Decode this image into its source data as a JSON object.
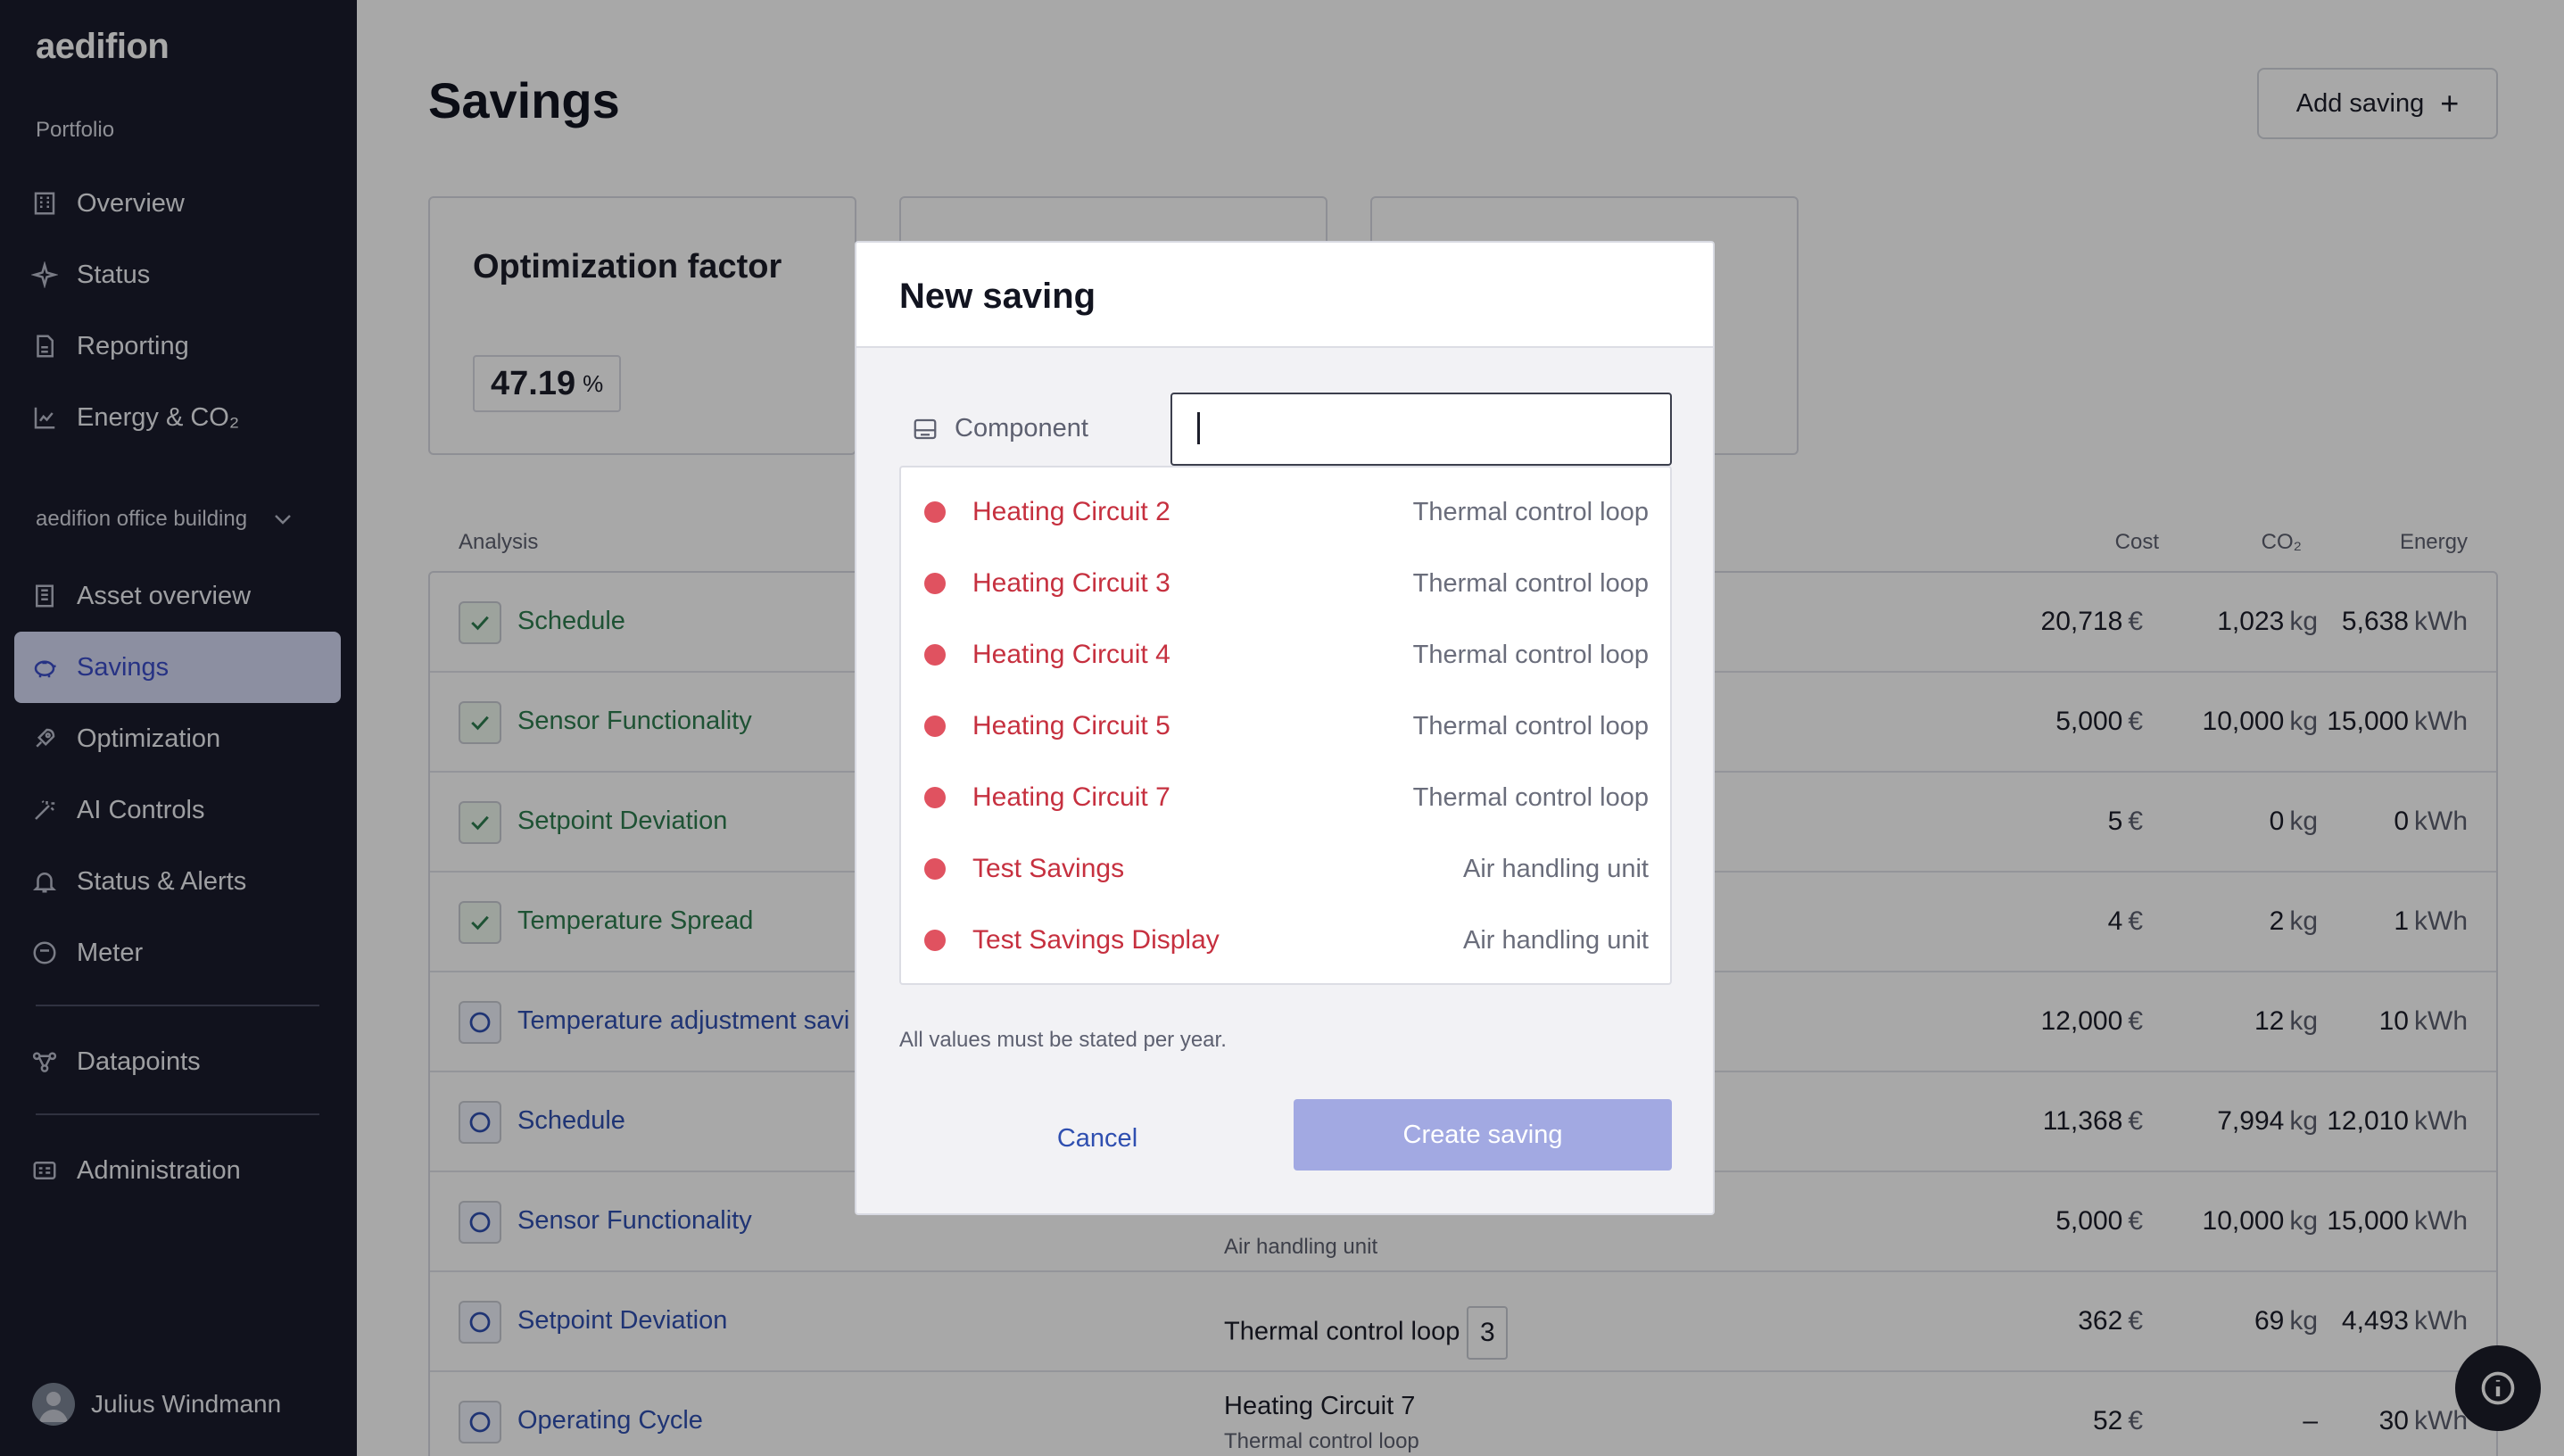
{
  "sidebar": {
    "logo": "aedifion",
    "portfolio_label": "Portfolio",
    "portfolio_items": [
      {
        "label": "Overview",
        "icon": "building-icon"
      },
      {
        "label": "Status",
        "icon": "sparkle-icon"
      },
      {
        "label": "Reporting",
        "icon": "report-icon"
      },
      {
        "label": "Energy & CO₂",
        "icon": "chart-icon"
      }
    ],
    "building_selector": "aedifion office building",
    "building_items": [
      {
        "label": "Asset overview",
        "icon": "asset-icon"
      },
      {
        "label": "Savings",
        "icon": "piggy-bank-icon",
        "active": true
      },
      {
        "label": "Optimization",
        "icon": "rocket-icon"
      },
      {
        "label": "AI Controls",
        "icon": "magic-wand-icon"
      },
      {
        "label": "Status & Alerts",
        "icon": "bell-icon"
      },
      {
        "label": "Meter",
        "icon": "gauge-icon"
      }
    ],
    "datapoints_label": "Datapoints",
    "administration_label": "Administration",
    "user_name": "Julius Windmann"
  },
  "main": {
    "title": "Savings",
    "add_button": "Add saving",
    "card1": {
      "title": "Optimization factor",
      "value": "47.19",
      "unit": "%"
    },
    "table_headers": {
      "analysis": "Analysis",
      "cost": "Cost",
      "co2": "CO₂",
      "energy": "Energy"
    },
    "rows": [
      {
        "name": "Schedule",
        "status": "checked",
        "comp": "",
        "comp_sub": "",
        "badge": "",
        "cost": "20,718",
        "co2": "1,023",
        "energy": "5,638"
      },
      {
        "name": "Sensor Functionality",
        "status": "checked",
        "comp": "",
        "comp_sub": "",
        "badge": "",
        "cost": "5,000",
        "co2": "10,000",
        "energy": "15,000"
      },
      {
        "name": "Setpoint Deviation",
        "status": "checked",
        "comp": "",
        "comp_sub": "",
        "badge": "",
        "cost": "5",
        "co2": "0",
        "energy": "0"
      },
      {
        "name": "Temperature Spread",
        "status": "checked",
        "comp": "",
        "comp_sub": "",
        "badge": "",
        "cost": "4",
        "co2": "2",
        "energy": "1"
      },
      {
        "name": "Temperature adjustment savi",
        "status": "open",
        "comp": "",
        "comp_sub": "",
        "badge": "",
        "cost": "12,000",
        "co2": "12",
        "energy": "10"
      },
      {
        "name": "Schedule",
        "status": "open",
        "comp": "",
        "comp_sub": "",
        "badge": "",
        "cost": "11,368",
        "co2": "7,994",
        "energy": "12,010"
      },
      {
        "name": "Sensor Functionality",
        "status": "open",
        "comp": "",
        "comp_sub": "Air handling unit",
        "badge": "",
        "cost": "5,000",
        "co2": "10,000",
        "energy": "15,000"
      },
      {
        "name": "Setpoint Deviation",
        "status": "open",
        "comp": "Thermal control loop",
        "comp_sub": "",
        "badge": "3",
        "cost": "362",
        "co2": "69",
        "energy": "4,493"
      },
      {
        "name": "Operating Cycle",
        "status": "open",
        "comp": "Heating Circuit 7",
        "comp_sub": "Thermal control loop",
        "badge": "",
        "cost": "52",
        "co2": "–",
        "energy": "30"
      }
    ],
    "units": {
      "cost": "€",
      "co2": "kg",
      "energy": "kWh"
    }
  },
  "modal": {
    "title": "New saving",
    "component_label": "Component",
    "component_value": "",
    "options": [
      {
        "name": "Heating Circuit 2",
        "type": "Thermal control loop"
      },
      {
        "name": "Heating Circuit 3",
        "type": "Thermal control loop"
      },
      {
        "name": "Heating Circuit 4",
        "type": "Thermal control loop"
      },
      {
        "name": "Heating Circuit 5",
        "type": "Thermal control loop"
      },
      {
        "name": "Heating Circuit 7",
        "type": "Thermal control loop"
      },
      {
        "name": "Test Savings",
        "type": "Air handling unit"
      },
      {
        "name": "Test Savings Display",
        "type": "Air handling unit"
      }
    ],
    "hint": "All values must be stated per year.",
    "cancel": "Cancel",
    "create": "Create saving"
  },
  "colors": {
    "sidebar_bg": "#1a1c2c",
    "accent": "#3b4cc8",
    "option_text": "#c6303f",
    "dot": "#e05260",
    "create_button": "#a2a9e2"
  }
}
